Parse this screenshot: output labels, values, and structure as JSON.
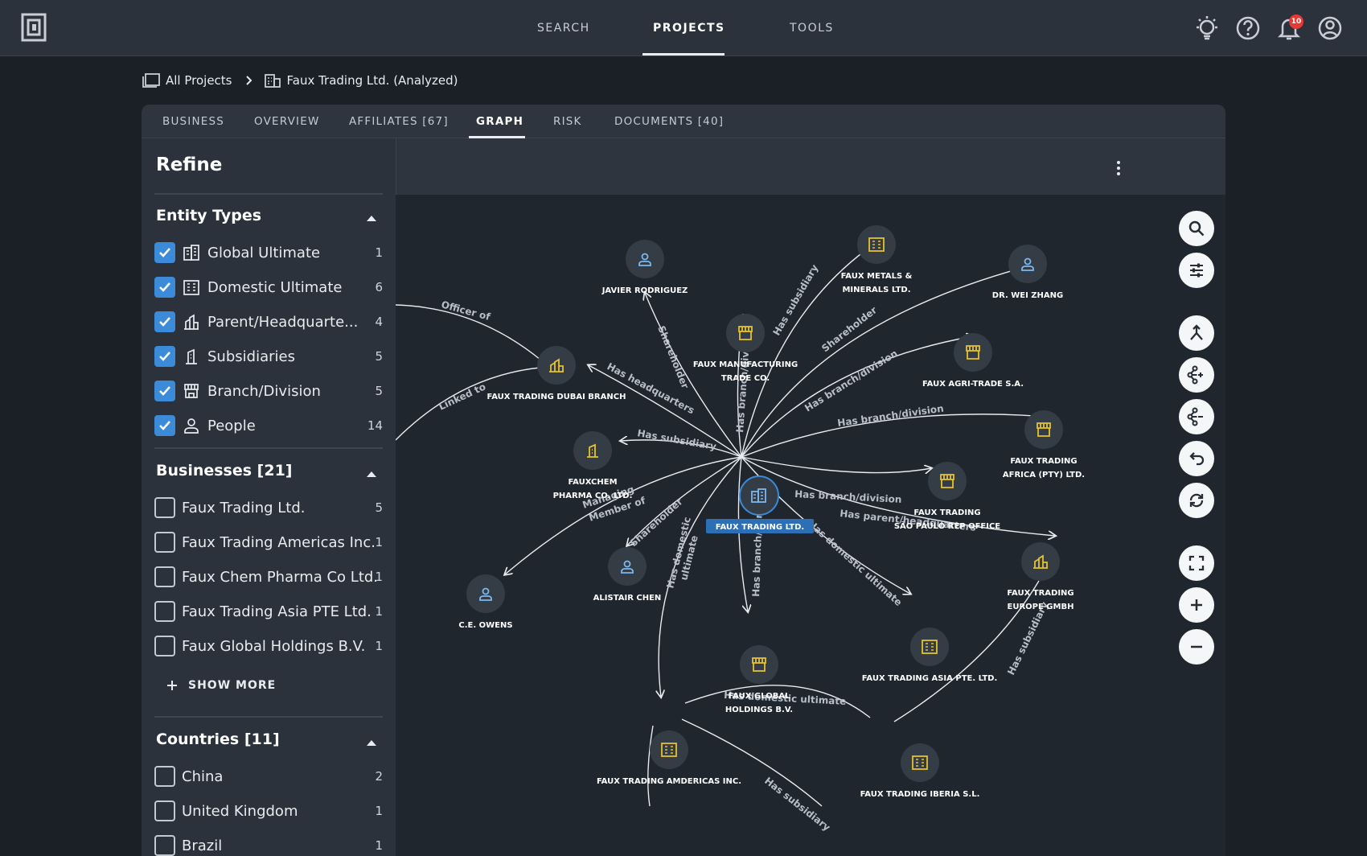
{
  "nav": {
    "search": "SEARCH",
    "projects": "PROJECTS",
    "tools": "TOOLS",
    "notifications_count": "10"
  },
  "breadcrumb": {
    "all_projects": "All Projects",
    "current": "Faux Trading Ltd. (Analyzed)"
  },
  "tabs": [
    "BUSINESS",
    "OVERVIEW",
    "AFFILIATES [67]",
    "GRAPH",
    "RISK",
    "DOCUMENTS [40]"
  ],
  "active_tab": "GRAPH",
  "sidebar": {
    "title": "Refine",
    "entity_types": {
      "title": "Entity Types",
      "items": [
        {
          "label": "Global Ultimate",
          "count": "1",
          "checked": true,
          "icon": "global-ultimate-icon"
        },
        {
          "label": "Domestic Ultimate",
          "count": "6",
          "checked": true,
          "icon": "domestic-ultimate-icon"
        },
        {
          "label": "Parent/Headquarte...",
          "count": "4",
          "checked": true,
          "icon": "parent-headquarters-icon"
        },
        {
          "label": "Subsidiaries",
          "count": "5",
          "checked": true,
          "icon": "subsidiary-icon"
        },
        {
          "label": "Branch/Division",
          "count": "5",
          "checked": true,
          "icon": "branch-icon"
        },
        {
          "label": "People",
          "count": "14",
          "checked": true,
          "icon": "person-icon"
        }
      ]
    },
    "businesses": {
      "title": "Businesses [21]",
      "items": [
        {
          "label": "Faux Trading Ltd.",
          "count": "5"
        },
        {
          "label": "Faux Trading Americas Inc.",
          "count": "1"
        },
        {
          "label": "Faux Chem Pharma Co Ltd.",
          "count": "1"
        },
        {
          "label": "Faux Trading Asia PTE Ltd.",
          "count": "1"
        },
        {
          "label": "Faux Global Holdings B.V.",
          "count": "1"
        }
      ],
      "show_more": "SHOW MORE"
    },
    "countries": {
      "title": "Countries [11]",
      "items": [
        {
          "label": "China",
          "count": "2"
        },
        {
          "label": "United Kingdom",
          "count": "1"
        },
        {
          "label": "Brazil",
          "count": "1"
        }
      ]
    }
  },
  "graph": {
    "center": "FAUX TRADING LTD.",
    "nodes": {
      "javier": "JAVIER RODRIGUEZ",
      "metals_1": "FAUX METALS &",
      "metals_2": "MINERALS LTD.",
      "wei": "DR. WEI ZHANG",
      "manuf_1": "FAUX MANUFACTURING",
      "manuf_2": "TRADE CO.",
      "agri": "FAUX AGRI-TRADE S.A.",
      "dubai": "FAUX TRADING DUBAI BRANCH",
      "africa_1": "FAUX TRADING",
      "africa_2": "AFRICA (PTY) LTD.",
      "pharma_1": "FAUXCHEM",
      "pharma_2": "PHARMA CO. LTD.",
      "saopaulo_1": "FAUX TRADING",
      "saopaulo_2": "SÃO PAULO REP OFFICE",
      "europe_1": "FAUX TRADING",
      "europe_2": "EUROPE GMBH",
      "owens": "C.E. OWENS",
      "chen": "ALISTAIR CHEN",
      "asia": "FAUX TRADING ASIA PTE. LTD.",
      "global_1": "FAUX GLOBAL",
      "global_2": "HOLDINGS B.V.",
      "americas": "FAUX TRADING AMDERICAS INC.",
      "iberia": "FAUX TRADING IBERIA S.L."
    },
    "edges": {
      "officer_of": "Officer of",
      "linked_to": "Linked to",
      "has_headquarters": "Has headquarters",
      "shareholder_1": "Shareholder",
      "has_branch_div": "Has branch/divis",
      "has_subsidiary_1": "Has subsidiary",
      "shareholder_2": "Shareholder",
      "has_branch_division_1": "Has branch/division",
      "has_branch_division_2": "Has branch/division",
      "has_subsidiary_2": "Has subsidiary",
      "has_branch_division_3": "Has branch/division",
      "managing_1": "Managing",
      "managing_2": "Member of",
      "shareholder_3": "Shareholder",
      "has_parent_hq": "Has parent/headquarters",
      "has_domestic_ultimate_1": "Has domestic ultimate",
      "has_branch_parent": "Has branch/parent",
      "has_domestic_2a": "Has domestic",
      "has_domestic_2b": "ultimate",
      "has_domestic_ultimate_3": "Has domestic ultimate",
      "has_subsidiary_3": "Has subsidiary",
      "has_subsidiary_4": "Has subsidiary"
    }
  },
  "colors": {
    "accent": "#3b8bd9",
    "business_icon": "#e6c229",
    "person_icon": "#7cb7ef",
    "node_bg": "#343c46"
  }
}
